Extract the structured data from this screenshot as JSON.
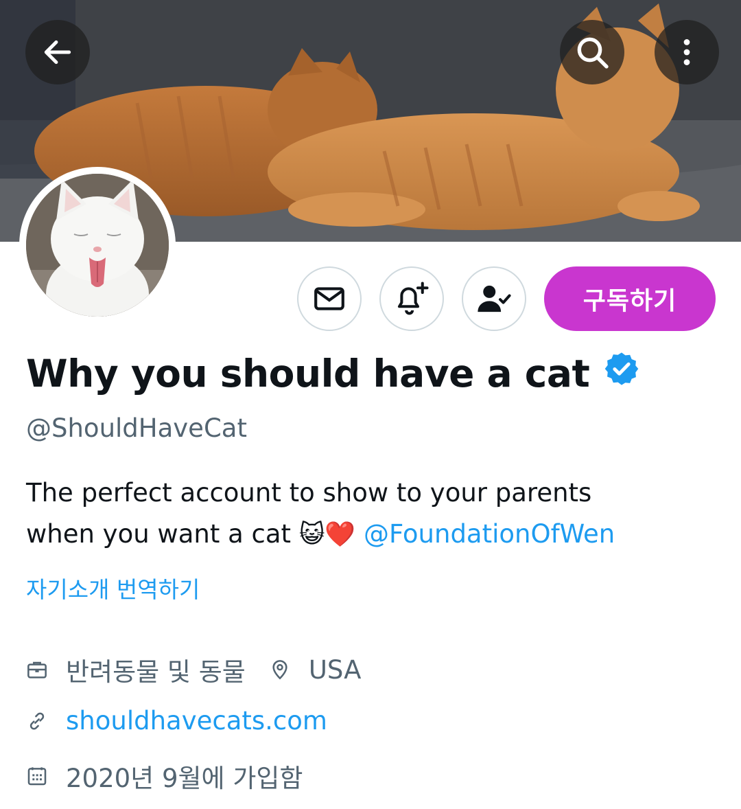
{
  "header": {
    "back_icon": "arrow-left-icon",
    "search_icon": "search-icon",
    "more_icon": "more-vertical-icon"
  },
  "actions": {
    "message_icon": "envelope-icon",
    "notify_icon": "bell-plus-icon",
    "following_icon": "person-check-icon",
    "subscribe_label": "구독하기",
    "subscribe_color": "#c936cf"
  },
  "profile": {
    "display_name": "Why you should have a cat",
    "verified_icon": "verified-badge-icon",
    "handle": "@ShouldHaveCat",
    "bio_line1": "The perfect account to show to your parents",
    "bio_line2_text": "when you want a cat ",
    "bio_emoji": "😺❤️",
    "bio_mention": "@FoundationOfWen",
    "translate_label": "자기소개 번역하기"
  },
  "meta": {
    "category": "반려동물 및 동물",
    "location": "USA",
    "website": "shouldhavecats.com",
    "joined": "2020년 9월에 가입함"
  },
  "colors": {
    "text": "#0f1419",
    "secondary": "#536471",
    "link": "#1d9bf0"
  }
}
